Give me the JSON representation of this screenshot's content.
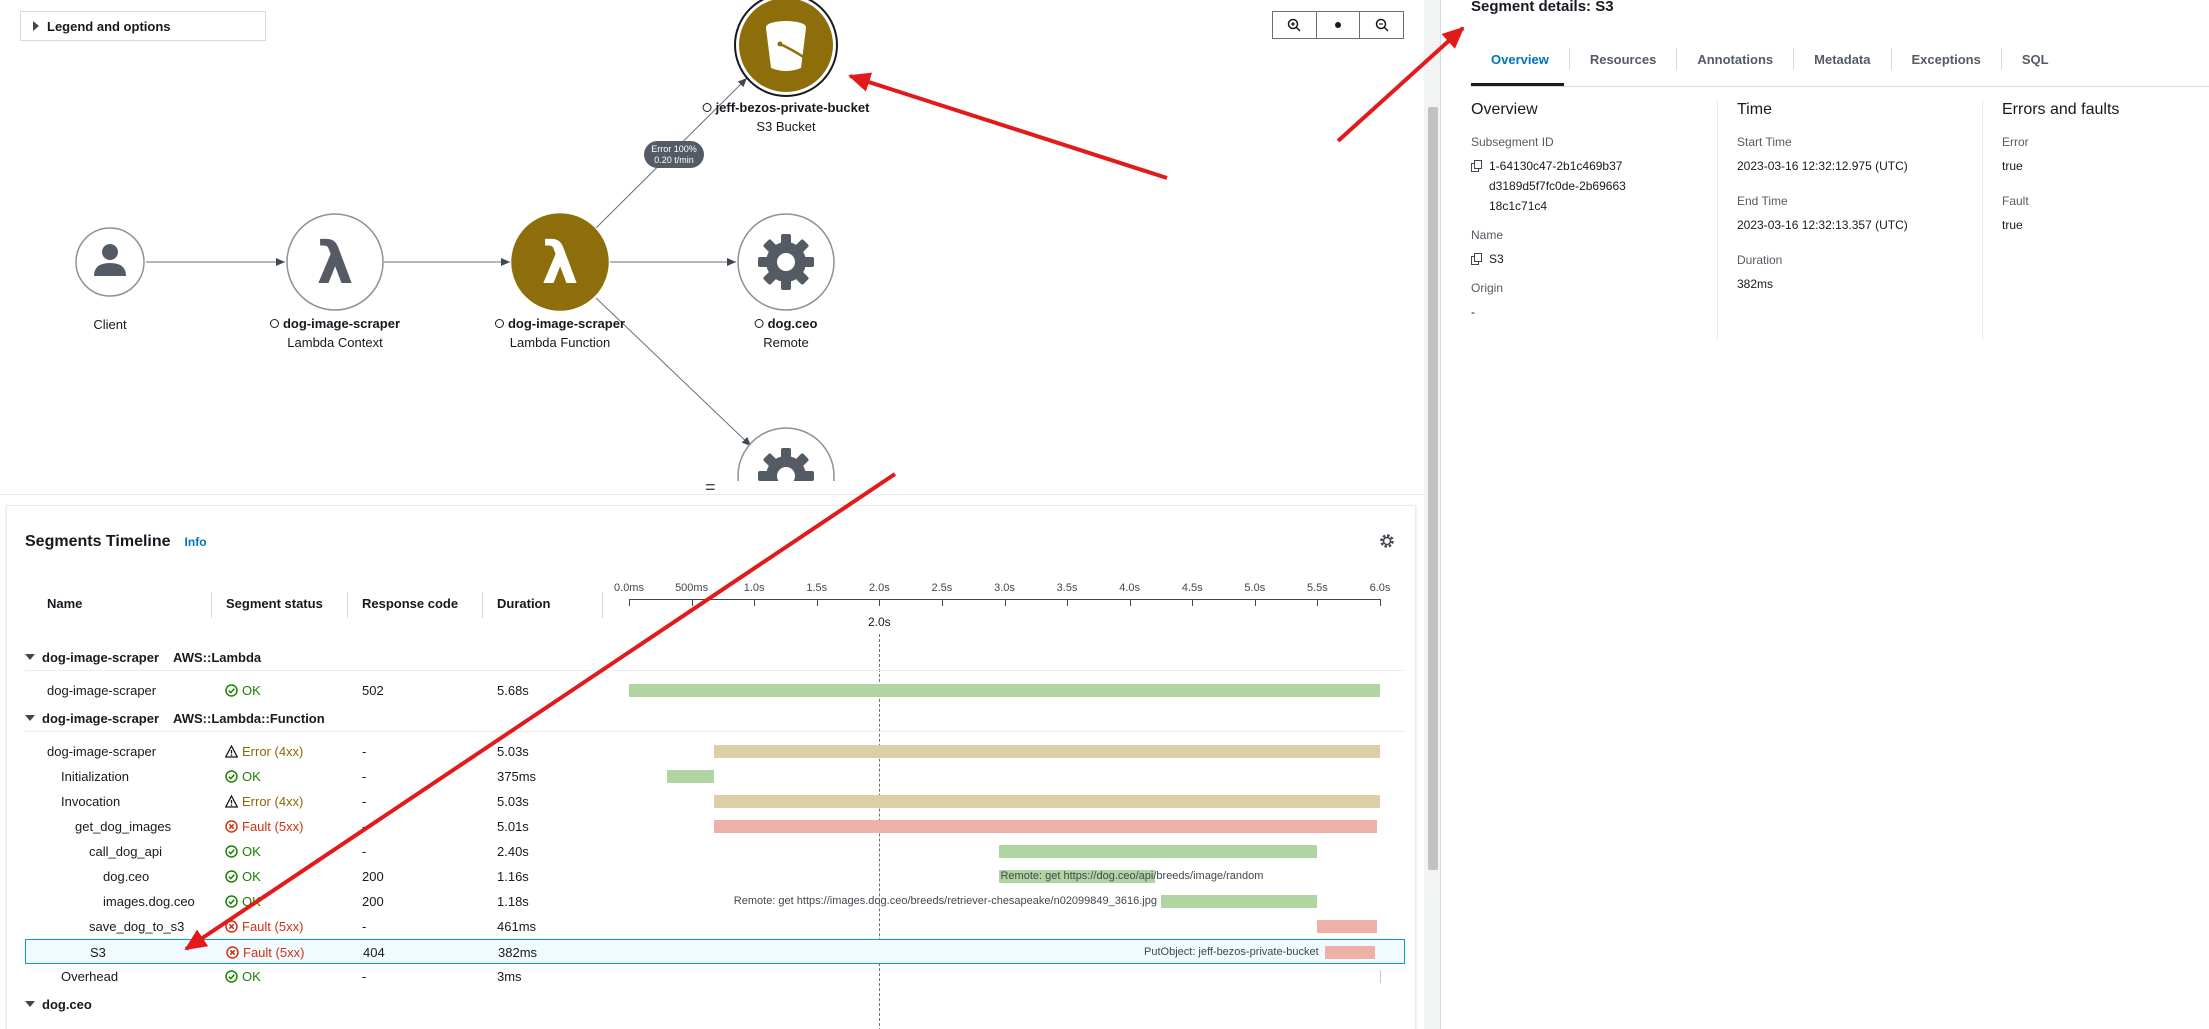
{
  "map": {
    "legend_toggle": "Legend and options",
    "nodes": [
      {
        "id": "client",
        "title": "",
        "subtitle": "Client",
        "icon": "user-icon"
      },
      {
        "id": "lambda_context",
        "title": "dog-image-scraper",
        "subtitle": "Lambda Context",
        "icon": "lambda-icon"
      },
      {
        "id": "lambda_function",
        "title": "dog-image-scraper",
        "subtitle": "Lambda Function",
        "icon": "lambda-icon"
      },
      {
        "id": "s3_bucket",
        "title": "jeff-bezos-private-bucket",
        "subtitle": "S3 Bucket",
        "icon": "bucket-icon"
      },
      {
        "id": "dog_ceo",
        "title": "dog.ceo",
        "subtitle": "Remote",
        "icon": "gear-icon"
      }
    ],
    "edge_badge": {
      "line1": "Error 100%",
      "line2": "0.20 t/min"
    },
    "colors": {
      "warning_node": "#8d6e0a",
      "node_border": "#879596",
      "edge": "#687078",
      "annotation_arrow": "#e31a1c"
    }
  },
  "timeline": {
    "title": "Segments Timeline",
    "info": "Info",
    "columns": {
      "name": "Name",
      "status": "Segment status",
      "code": "Response code",
      "duration": "Duration"
    },
    "axis_ticks": [
      "0.0ms",
      "500ms",
      "1.0s",
      "1.5s",
      "2.0s",
      "2.5s",
      "3.0s",
      "3.5s",
      "4.0s",
      "4.5s",
      "5.0s",
      "5.5s",
      "6.0s"
    ],
    "axis_max_s": 6.0,
    "cursor_label": "2.0s",
    "cursor_s": 2.0,
    "groups": [
      {
        "name": "dog-image-scraper",
        "service": "AWS::Lambda",
        "rows": [
          {
            "name": "dog-image-scraper",
            "indent": 0,
            "status": "OK",
            "status_type": "ok",
            "code": "502",
            "duration": "5.68s",
            "start": 0.0,
            "end": 6.0,
            "bar_color": "#b1d5a2"
          }
        ]
      },
      {
        "name": "dog-image-scraper",
        "service": "AWS::Lambda::Function",
        "rows": [
          {
            "name": "dog-image-scraper",
            "indent": 0,
            "status": "Error (4xx)",
            "status_type": "error",
            "code": "-",
            "duration": "5.03s",
            "start": 0.68,
            "end": 6.0,
            "bar_color": "#dccfa8"
          },
          {
            "name": "Initialization",
            "indent": 1,
            "status": "OK",
            "status_type": "ok",
            "code": "-",
            "duration": "375ms",
            "start": 0.3,
            "end": 0.68,
            "bar_color": "#b1d5a2"
          },
          {
            "name": "Invocation",
            "indent": 1,
            "status": "Error (4xx)",
            "status_type": "error",
            "code": "-",
            "duration": "5.03s",
            "start": 0.68,
            "end": 6.0,
            "bar_color": "#dccfa8"
          },
          {
            "name": "get_dog_images",
            "indent": 2,
            "status": "Fault (5xx)",
            "status_type": "fault",
            "code": "-",
            "duration": "5.01s",
            "start": 0.68,
            "end": 5.98,
            "bar_color": "#edb1a8"
          },
          {
            "name": "call_dog_api",
            "indent": 3,
            "status": "OK",
            "status_type": "ok",
            "code": "-",
            "duration": "2.40s",
            "start": 2.96,
            "end": 5.5,
            "bar_color": "#b1d5a2"
          },
          {
            "name": "dog.ceo",
            "indent": 4,
            "status": "OK",
            "status_type": "ok",
            "code": "200",
            "duration": "1.16s",
            "start": 2.96,
            "end": 4.2,
            "bar_color": "#b1d5a2",
            "bar_label": "Remote: get https://dog.ceo/api/breeds/image/random",
            "label_side": "over"
          },
          {
            "name": "images.dog.ceo",
            "indent": 4,
            "status": "OK",
            "status_type": "ok",
            "code": "200",
            "duration": "1.18s",
            "start": 4.25,
            "end": 5.5,
            "bar_color": "#b1d5a2",
            "bar_label": "Remote: get https://images.dog.ceo/breeds/retriever-chesapeake/n02099849_3616.jpg",
            "label_side": "left"
          },
          {
            "name": "save_dog_to_s3",
            "indent": 3,
            "status": "Fault (5xx)",
            "status_type": "fault",
            "code": "-",
            "duration": "461ms",
            "start": 5.5,
            "end": 5.98,
            "bar_color": "#edb1a8"
          },
          {
            "name": "S3",
            "indent": 3,
            "status": "Fault (5xx)",
            "status_type": "fault",
            "code": "404",
            "duration": "382ms",
            "start": 5.55,
            "end": 5.95,
            "bar_color": "#edb1a8",
            "bar_label": "PutObject: jeff-bezos-private-bucket",
            "label_side": "left",
            "selected": true
          },
          {
            "name": "Overhead",
            "indent": 1,
            "status": "OK",
            "status_type": "ok",
            "code": "-",
            "duration": "3ms",
            "start": 6.0,
            "end": 6.0,
            "bar_color": "#b1d5a2"
          }
        ]
      },
      {
        "name": "dog.ceo",
        "service": "",
        "rows": []
      }
    ]
  },
  "details": {
    "title": "Segment details: S3",
    "tabs": [
      "Overview",
      "Resources",
      "Annotations",
      "Metadata",
      "Exceptions",
      "SQL"
    ],
    "active_tab": "Overview",
    "overview": {
      "heading": "Overview",
      "subsegment_id_label": "Subsegment ID",
      "subsegment_id": "1-64130c47-2b1c469b37d3189d5f7fc0de-2b6966318c1c71c4",
      "name_label": "Name",
      "name": "S3",
      "origin_label": "Origin",
      "origin": "-"
    },
    "time": {
      "heading": "Time",
      "start_label": "Start Time",
      "start": "2023-03-16 12:32:12.975 (UTC)",
      "end_label": "End Time",
      "end": "2023-03-16 12:32:13.357 (UTC)",
      "duration_label": "Duration",
      "duration": "382ms"
    },
    "errors": {
      "heading": "Errors and faults",
      "error_label": "Error",
      "error": "true",
      "fault_label": "Fault",
      "fault": "true"
    }
  }
}
